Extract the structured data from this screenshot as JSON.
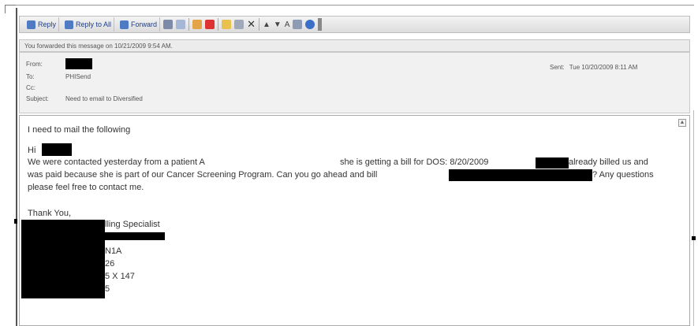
{
  "toolbar": {
    "reply": "Reply",
    "reply_all": "Reply to All",
    "forward": "Forward",
    "font_label": "A"
  },
  "infobar": {
    "text": "You forwarded this message on 10/21/2009 9:54 AM."
  },
  "header": {
    "from_label": "From:",
    "to_label": "To:",
    "to_value": "PHISend",
    "cc_label": "Cc:",
    "subject_label": "Subject:",
    "subject_value": "Need to email to Diversified",
    "sent_label": "Sent:",
    "sent_value": "Tue 10/20/2009 8:11 AM"
  },
  "body": {
    "line1": "I need to mail the following",
    "hi": "Hi",
    "para1a": "We were contacted yesterday from a patient A",
    "para1b": "she is getting a bill for DOS: 8/20/2009",
    "para1c": "already billed us and",
    "para2a": "was paid because she is part of our Cancer Screening Program. Can you go ahead and bill",
    "para2b": "? Any questions",
    "para3": "please feel free to contact me.",
    "thanks": "Thank You,",
    "sig1": "lling Specialist",
    "sig2": "N1A",
    "sig3": "26",
    "sig4": "5 X 147",
    "sig5": "5"
  },
  "colors": {
    "redaction": "#000000",
    "toolbar_text": "#1c3f8f"
  },
  "icons": [
    "reply-icon",
    "reply-all-icon",
    "forward-icon",
    "print-icon",
    "move-icon",
    "categorize-icon",
    "flag-icon",
    "contacts-icon",
    "rules-icon",
    "delete-icon",
    "up-icon",
    "down-icon",
    "font-size-icon",
    "address-book-icon",
    "help-icon"
  ]
}
